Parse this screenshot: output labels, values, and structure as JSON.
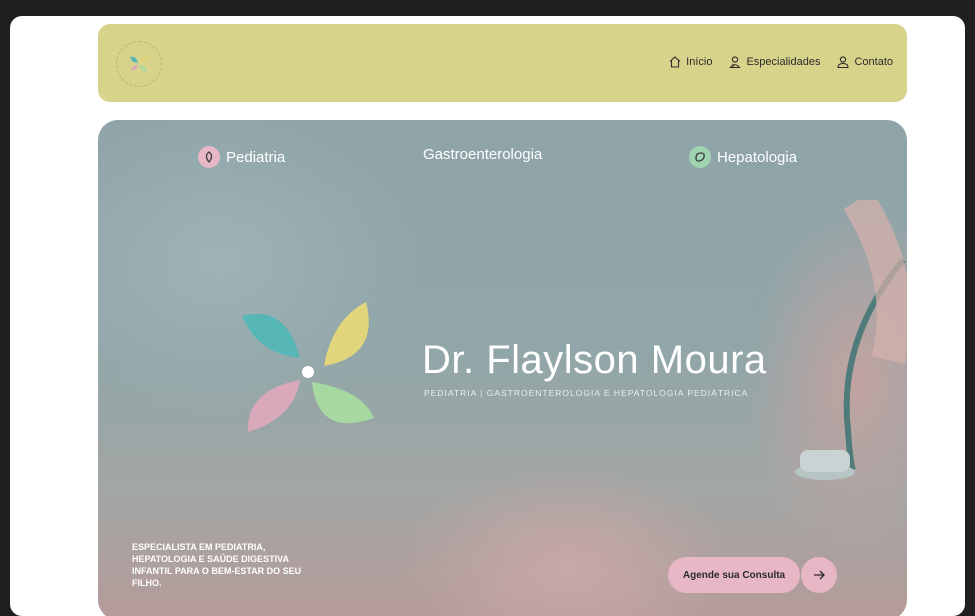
{
  "nav": {
    "items": [
      {
        "label": "Início",
        "icon": "home-icon"
      },
      {
        "label": "Especialidades",
        "icon": "doctor-icon"
      },
      {
        "label": "Contato",
        "icon": "user-icon"
      }
    ]
  },
  "hero": {
    "specialties": [
      {
        "label": "Pediatria",
        "icon": "pediatrics-icon",
        "color": "#e7b7c6"
      },
      {
        "label": "Gastroenterologia",
        "icon": "",
        "color": ""
      },
      {
        "label": "Hepatologia",
        "icon": "liver-icon",
        "color": "#9fd4b0"
      }
    ],
    "brand_name": "Dr. Flaylson Moura",
    "brand_subtitle": "PEDIATRIA | GASTROENTEROLOGIA E HEPATOLOGIA PEDIÁTRICA",
    "tagline": "ESPECIALISTA EM PEDIATRIA, HEPATOLOGIA E SAÚDE DIGESTIVA INFANTIL PARA O BEM-ESTAR DO SEU FILHO.",
    "cta_label": "Agende sua Consulta"
  },
  "colors": {
    "header_bg": "#d8d38a",
    "cta_bg": "#e7b7c6",
    "petal_teal": "#57b7b7",
    "petal_yellow": "#e1d67c",
    "petal_pink": "#d9a9bb",
    "petal_green": "#a6d8a0"
  }
}
